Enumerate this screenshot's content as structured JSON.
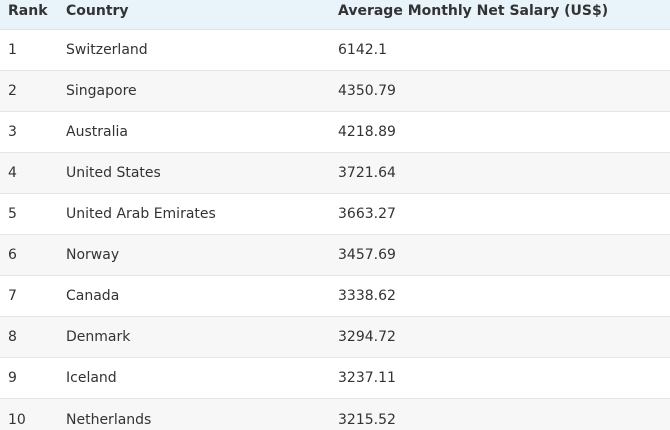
{
  "table": {
    "headers": {
      "rank": "Rank",
      "country": "Country",
      "salary": "Average Monthly Net Salary (US$)"
    },
    "rows": [
      {
        "rank": "1",
        "country": "Switzerland",
        "salary": "6142.1"
      },
      {
        "rank": "2",
        "country": "Singapore",
        "salary": "4350.79"
      },
      {
        "rank": "3",
        "country": "Australia",
        "salary": "4218.89"
      },
      {
        "rank": "4",
        "country": "United States",
        "salary": "3721.64"
      },
      {
        "rank": "5",
        "country": "United Arab Emirates",
        "salary": "3663.27"
      },
      {
        "rank": "6",
        "country": "Norway",
        "salary": "3457.69"
      },
      {
        "rank": "7",
        "country": "Canada",
        "salary": "3338.62"
      },
      {
        "rank": "8",
        "country": "Denmark",
        "salary": "3294.72"
      },
      {
        "rank": "9",
        "country": "Iceland",
        "salary": "3237.11"
      },
      {
        "rank": "10",
        "country": "Netherlands",
        "salary": "3215.52"
      }
    ]
  }
}
